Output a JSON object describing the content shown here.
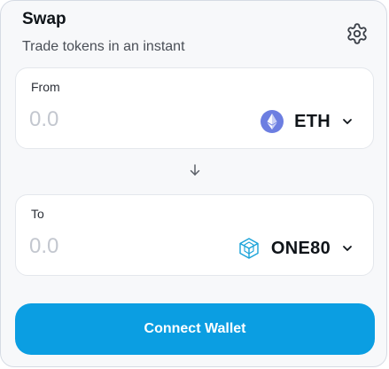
{
  "header": {
    "title": "Swap",
    "subtitle": "Trade tokens in an instant",
    "settings_icon": "gear-icon"
  },
  "from": {
    "label": "From",
    "amount_placeholder": "0.0",
    "token": {
      "symbol": "ETH",
      "icon": "ethereum-icon",
      "icon_color": "#6c7ee1"
    }
  },
  "switch_icon": "arrow-down-icon",
  "to": {
    "label": "To",
    "amount_placeholder": "0.0",
    "token": {
      "symbol": "ONE80",
      "icon": "one80-cube-icon",
      "icon_color": "#1aa3d9"
    }
  },
  "action": {
    "connect_label": "Connect Wallet",
    "color": "#0b9ee2"
  }
}
